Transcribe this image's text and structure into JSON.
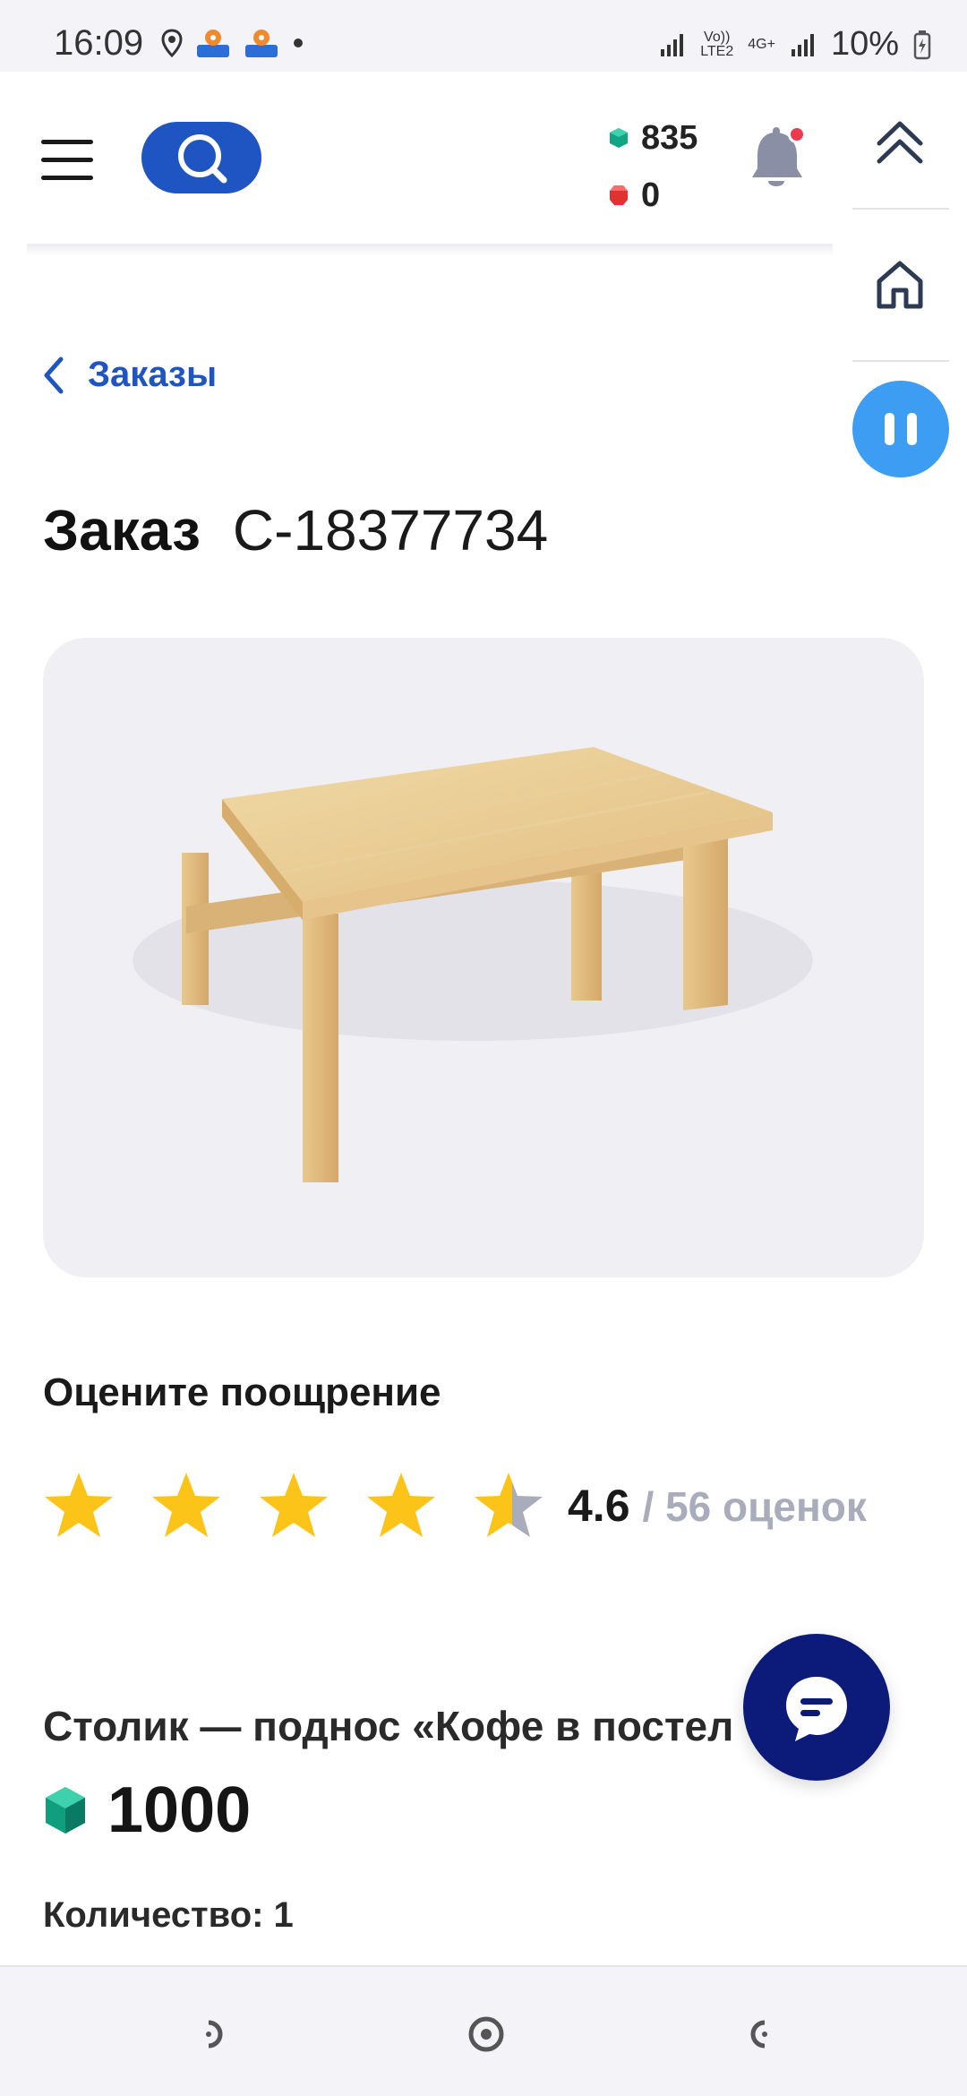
{
  "status_bar": {
    "time": "16:09",
    "network_label_top": "Vo))",
    "network_label_bottom": "LTE2",
    "net_type": "4G+",
    "battery": "10%",
    "icons": [
      "location-icon",
      "maps-icon",
      "maps-icon",
      "dot-icon",
      "signal-icon",
      "signal-icon",
      "battery-charging-icon"
    ]
  },
  "header": {
    "menu_icon": "hamburger-icon",
    "search_icon": "search-icon",
    "points_green": "835",
    "points_red": "0",
    "notification_icon": "bell-icon",
    "accent": "#1f55c2"
  },
  "side_rail": {
    "icons": [
      "double-chevron-up-icon",
      "home-icon",
      "pause-icon"
    ]
  },
  "breadcrumb": {
    "label": "Заказы"
  },
  "order": {
    "label": "Заказ",
    "code": "С-18377734"
  },
  "product_image": {
    "alt": "wooden tray table"
  },
  "rating": {
    "heading": "Оцените поощрение",
    "stars": 4.6,
    "average": "4.6",
    "count": "/ 56 оценок",
    "star_color": "#fcc419"
  },
  "product": {
    "name": "Столик — поднос «Кофе в постел",
    "price": "1000",
    "quantity": "Количество: 1"
  },
  "chat": {
    "icon": "chat-icon",
    "color": "#0c1a7a"
  },
  "navbar": {
    "icons": [
      "back-icon",
      "home-circle-icon",
      "recents-icon"
    ]
  }
}
